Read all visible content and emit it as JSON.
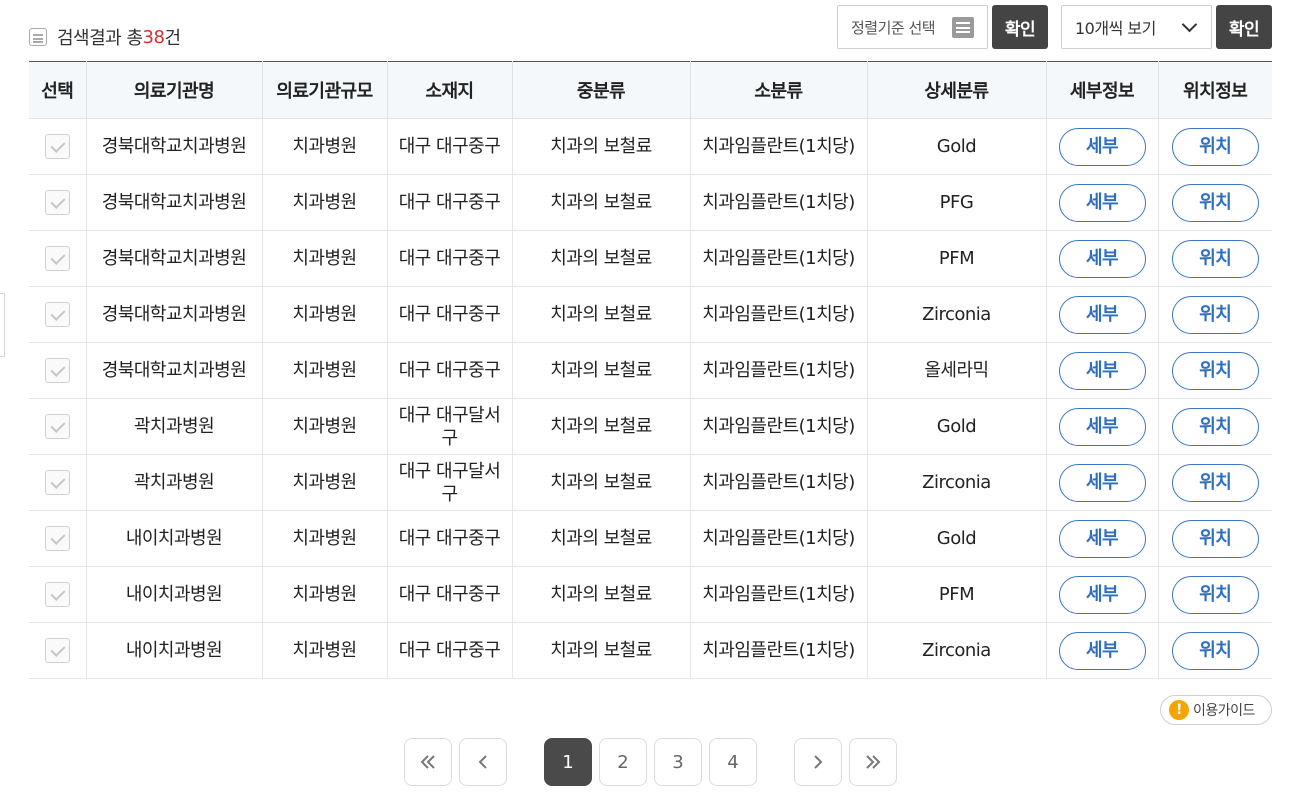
{
  "summary": {
    "prefix": "검색결과 총",
    "count": "38",
    "suffix": "건"
  },
  "controls": {
    "sort_placeholder": "정렬기준 선택",
    "confirm_label": "확인",
    "per_page_value": "10개씩 보기"
  },
  "table": {
    "headers": [
      "선택",
      "의료기관명",
      "의료기관규모",
      "소재지",
      "중분류",
      "소분류",
      "상세분류",
      "세부정보",
      "위치정보"
    ],
    "detail_label": "세부",
    "location_label": "위치",
    "rows": [
      {
        "institution": "경북대학교치과병원",
        "size": "치과병원",
        "location": "대구 대구중구",
        "category": "치과의 보철료",
        "subcategory": "치과임플란트(1치당)",
        "detail": "Gold"
      },
      {
        "institution": "경북대학교치과병원",
        "size": "치과병원",
        "location": "대구 대구중구",
        "category": "치과의 보철료",
        "subcategory": "치과임플란트(1치당)",
        "detail": "PFG"
      },
      {
        "institution": "경북대학교치과병원",
        "size": "치과병원",
        "location": "대구 대구중구",
        "category": "치과의 보철료",
        "subcategory": "치과임플란트(1치당)",
        "detail": "PFM"
      },
      {
        "institution": "경북대학교치과병원",
        "size": "치과병원",
        "location": "대구 대구중구",
        "category": "치과의 보철료",
        "subcategory": "치과임플란트(1치당)",
        "detail": "Zirconia"
      },
      {
        "institution": "경북대학교치과병원",
        "size": "치과병원",
        "location": "대구 대구중구",
        "category": "치과의 보철료",
        "subcategory": "치과임플란트(1치당)",
        "detail": "올세라믹"
      },
      {
        "institution": "곽치과병원",
        "size": "치과병원",
        "location": "대구 대구달서구",
        "category": "치과의 보철료",
        "subcategory": "치과임플란트(1치당)",
        "detail": "Gold"
      },
      {
        "institution": "곽치과병원",
        "size": "치과병원",
        "location": "대구 대구달서구",
        "category": "치과의 보철료",
        "subcategory": "치과임플란트(1치당)",
        "detail": "Zirconia"
      },
      {
        "institution": "내이치과병원",
        "size": "치과병원",
        "location": "대구 대구중구",
        "category": "치과의 보철료",
        "subcategory": "치과임플란트(1치당)",
        "detail": "Gold"
      },
      {
        "institution": "내이치과병원",
        "size": "치과병원",
        "location": "대구 대구중구",
        "category": "치과의 보철료",
        "subcategory": "치과임플란트(1치당)",
        "detail": "PFM"
      },
      {
        "institution": "내이치과병원",
        "size": "치과병원",
        "location": "대구 대구중구",
        "category": "치과의 보철료",
        "subcategory": "치과임플란트(1치당)",
        "detail": "Zirconia"
      }
    ]
  },
  "guide_label": "이용가이드",
  "guide_icon": "exclamation-icon",
  "pagination": {
    "pages": [
      "1",
      "2",
      "3",
      "4"
    ],
    "current": "1"
  },
  "colors": {
    "accent": "#2e6fc2",
    "count": "#d2322d",
    "dark_button": "#444444",
    "warning": "#f5a400"
  }
}
